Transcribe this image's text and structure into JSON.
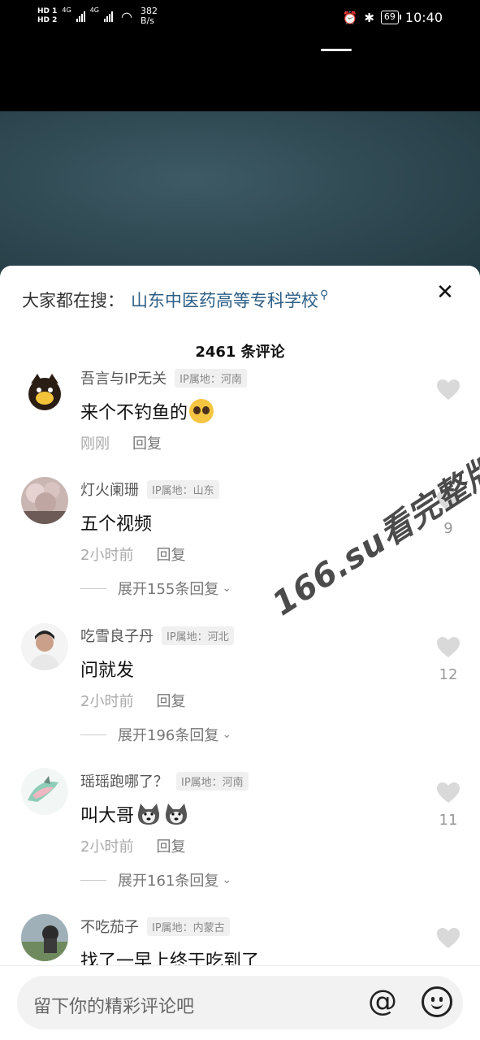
{
  "status_bar": {
    "hd1": "HD 1",
    "hd2": "HD 2",
    "net1": "4G",
    "net2": "4G",
    "speed_value": "382",
    "speed_unit": "B/s",
    "battery": "69",
    "time": "10:40"
  },
  "search": {
    "prefix": "大家都在搜：",
    "query": "山东中医药高等专科学校",
    "icon": "search-icon"
  },
  "close_icon": "close-icon",
  "comment_count": "2461 条评论",
  "comments": [
    {
      "user": "吾言与IP无关",
      "ip": "IP属地：河南",
      "text": "来个不钓鱼的",
      "emoji": "pleading-face-emoji",
      "time": "刚刚",
      "reply": "回复",
      "likes": ""
    },
    {
      "user": "灯火阑珊",
      "ip": "IP属地：山东",
      "text": "五个视频",
      "time": "2小时前",
      "reply": "回复",
      "likes": "9",
      "expand": "展开155条回复"
    },
    {
      "user": "吃雪良子丹",
      "ip": "IP属地：河北",
      "text": "问就发",
      "time": "2小时前",
      "reply": "回复",
      "likes": "12",
      "expand": "展开196条回复"
    },
    {
      "user": "瑶瑶跑哪了？",
      "ip": "IP属地：河南",
      "text": "叫大哥",
      "emoji": "husky-emoji",
      "time": "2小时前",
      "reply": "回复",
      "likes": "11",
      "expand": "展开161条回复"
    },
    {
      "user": "不吃茄子",
      "ip": "IP属地：内蒙古",
      "text": "找了一早上终于吃到了",
      "likes": ""
    }
  ],
  "watermark": "166.su看完整版",
  "input": {
    "placeholder": "留下你的精彩评论吧",
    "at_symbol": "@",
    "emoji_button": "emoji-icon"
  },
  "colors": {
    "link": "#2d5f86",
    "video_bg": "#2e4750",
    "heart": "#d9d9d9"
  }
}
